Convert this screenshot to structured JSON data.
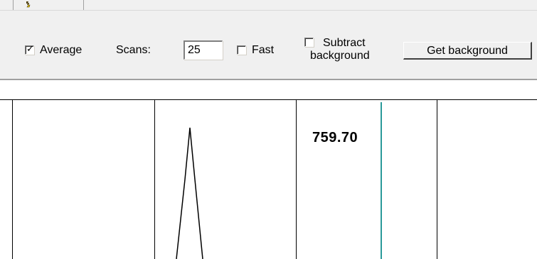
{
  "toolbar": {
    "icon": "sniff-icon"
  },
  "options": {
    "average": {
      "label": "Average",
      "checked": true
    },
    "scans": {
      "label": "Scans:",
      "value": "25"
    },
    "fast": {
      "label": "Fast",
      "checked": false
    },
    "subtract_background": {
      "label_line1": "Subtract",
      "label_line2": "background",
      "checked": false
    },
    "get_background": {
      "label": "Get background"
    }
  },
  "panel": {
    "peak_value": "759.70",
    "cursor_color": "#2a9a9a"
  }
}
